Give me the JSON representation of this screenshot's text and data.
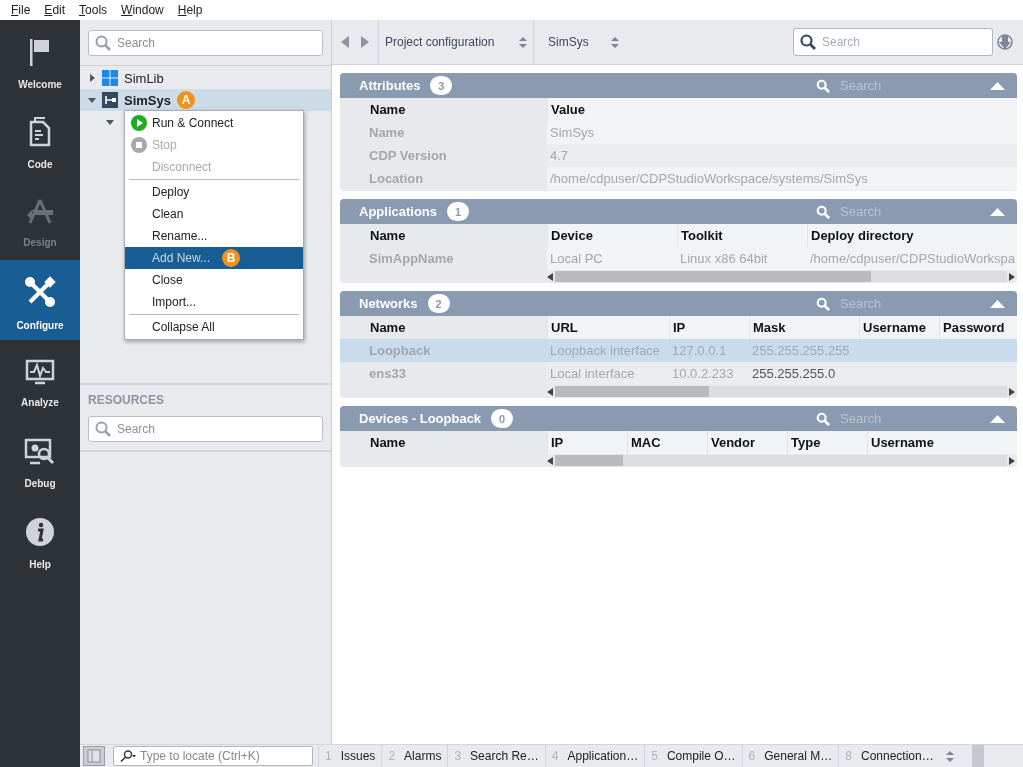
{
  "menu_bar": [
    "File",
    "Edit",
    "Tools",
    "Window",
    "Help"
  ],
  "modes": [
    {
      "kind": "welcome",
      "label": "Welcome",
      "selected": false,
      "disabled": false
    },
    {
      "kind": "code",
      "label": "Code",
      "selected": false,
      "disabled": false
    },
    {
      "kind": "design",
      "label": "Design",
      "selected": false,
      "disabled": true
    },
    {
      "kind": "configure",
      "label": "Configure",
      "selected": true,
      "disabled": false
    },
    {
      "kind": "analyze",
      "label": "Analyze",
      "selected": false,
      "disabled": false
    },
    {
      "kind": "debug",
      "label": "Debug",
      "selected": false,
      "disabled": false
    },
    {
      "kind": "help",
      "label": "Help",
      "selected": false,
      "disabled": false
    }
  ],
  "project_panel": {
    "search": {
      "placeholder": "Search"
    },
    "tree": [
      {
        "kind": "library",
        "label": "SimLib",
        "expanded": false,
        "selected": false
      },
      {
        "kind": "system",
        "label": "SimSys",
        "expanded": true,
        "selected": true,
        "marker": "A",
        "children": [
          {
            "expanded": true
          }
        ]
      }
    ],
    "resources": {
      "title": "RESOURCES",
      "search": {
        "placeholder": "Search"
      }
    }
  },
  "context_menu": {
    "marker": "B",
    "items": [
      {
        "kind": "run",
        "label": "Run & Connect",
        "disabled": false,
        "selected": false
      },
      {
        "kind": "stop",
        "label": "Stop",
        "disabled": true,
        "selected": false
      },
      {
        "kind": "item",
        "label": "Disconnect",
        "disabled": true,
        "selected": false
      },
      {
        "kind": "separator"
      },
      {
        "kind": "item",
        "label": "Deploy",
        "disabled": false,
        "selected": false
      },
      {
        "kind": "item",
        "label": "Clean",
        "disabled": false,
        "selected": false
      },
      {
        "kind": "item",
        "label": "Rename...",
        "disabled": false,
        "selected": false
      },
      {
        "kind": "item",
        "label": "Add New...",
        "disabled": false,
        "selected": true
      },
      {
        "kind": "item",
        "label": "Close",
        "disabled": false,
        "selected": false
      },
      {
        "kind": "item",
        "label": "Import...",
        "disabled": false,
        "selected": false
      },
      {
        "kind": "separator"
      },
      {
        "kind": "item",
        "label": "Collapse All",
        "disabled": false,
        "selected": false
      }
    ]
  },
  "toolbar": {
    "breadcrumb": [
      "Project configuration",
      "SimSys"
    ],
    "search": {
      "placeholder": "Search"
    }
  },
  "sections": [
    {
      "title": "Attributes",
      "count": "3",
      "search_placeholder": "Search",
      "columns": [
        "Name",
        "Value"
      ],
      "scrollbar": false,
      "rows": [
        {
          "cells": [
            "Name",
            "SimSys"
          ],
          "selected": false
        },
        {
          "cells": [
            "CDP Version",
            "4.7"
          ],
          "selected": false
        },
        {
          "cells": [
            "Location",
            "/home/cdpuser/CDPStudioWorkspace/systems/SimSys"
          ],
          "selected": false
        }
      ]
    },
    {
      "title": "Applications",
      "count": "1",
      "search_placeholder": "Search",
      "columns": [
        "Name",
        "Device",
        "Toolkit",
        "Deploy directory"
      ],
      "scrollbar": true,
      "rows": [
        {
          "cells": [
            "SimAppName",
            "Local PC",
            "Linux x86 64bit",
            "/home/cdpuser/CDPStudioWorkspa"
          ],
          "selected": false
        }
      ]
    },
    {
      "title": "Networks",
      "count": "2",
      "search_placeholder": "Search",
      "columns": [
        "Name",
        "URL",
        "IP",
        "Mask",
        "Username",
        "Password"
      ],
      "scrollbar": true,
      "rows": [
        {
          "cells": [
            "Loopback",
            "Loopback interface",
            "127.0.0.1",
            "255.255.255.255"
          ],
          "selected": true
        },
        {
          "cells": [
            "ens33",
            "Local interface",
            "10.0.2.233",
            "255.255.255.0"
          ],
          "selected": false
        }
      ]
    },
    {
      "title": "Devices - Loopback",
      "count": "0",
      "search_placeholder": "Search",
      "columns": [
        "Name",
        "IP",
        "MAC",
        "Vendor",
        "Type",
        "Username"
      ],
      "scrollbar": true
    }
  ],
  "bottom_bar": {
    "locate": {
      "placeholder": "Type to locate (Ctrl+K)"
    },
    "tabs": [
      {
        "number": "1",
        "label": "Issues"
      },
      {
        "number": "2",
        "label": "Alarms"
      },
      {
        "number": "3",
        "label": "Search Re…"
      },
      {
        "number": "4",
        "label": "Application…"
      },
      {
        "number": "5",
        "label": "Compile O…"
      },
      {
        "number": "6",
        "label": "General M…"
      },
      {
        "number": "8",
        "label": "Connection…"
      }
    ]
  }
}
